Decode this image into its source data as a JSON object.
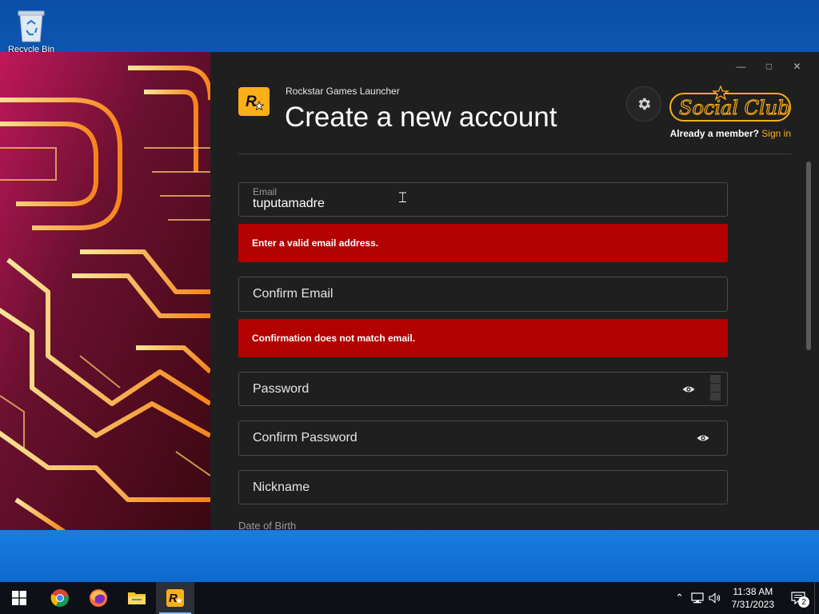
{
  "desktop": {
    "recycle_bin_label": "Recycle Bin"
  },
  "window": {
    "app_name": "Rockstar Games Launcher",
    "title": "Create a new account",
    "already_member": "Already a member?",
    "sign_in": "Sign in",
    "social_club_logo": "Social Club"
  },
  "form": {
    "email_label": "Email",
    "email_value": "tuputamadre",
    "email_error": "Enter a valid email address.",
    "confirm_email_placeholder": "Confirm Email",
    "confirm_email_error": "Confirmation does not match email.",
    "password_placeholder": "Password",
    "confirm_password_placeholder": "Confirm Password",
    "nickname_placeholder": "Nickname",
    "dob_label": "Date of Birth"
  },
  "colors": {
    "accent": "#fcaf17",
    "error": "#b30000",
    "panel": "#1f1f20"
  },
  "taskbar": {
    "apps": [
      "start-icon",
      "chrome-icon",
      "firefox-icon",
      "file-explorer-icon",
      "rockstar-launcher-icon"
    ],
    "time": "11:38 AM",
    "date": "7/31/2023",
    "notification_count": "2"
  }
}
